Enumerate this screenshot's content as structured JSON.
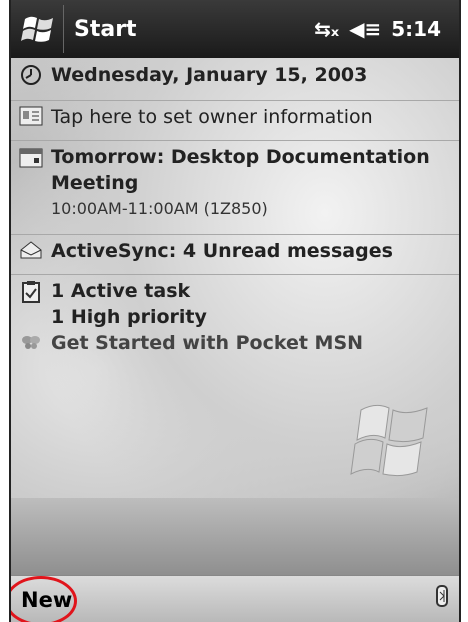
{
  "titlebar": {
    "title": "Start",
    "time": "5:14",
    "connectivity_icon": "connectivity-icon",
    "volume_icon": "speaker-icon"
  },
  "today": {
    "date": "Wednesday, January 15, 2003",
    "owner": "Tap here to set owner information",
    "appointment_title_line1": "Tomorrow: Desktop Documentation",
    "appointment_title_line2": "Meeting",
    "appointment_time": "10:00AM-11:00AM (1Z850)",
    "activesync": "ActiveSync: 4 Unread messages",
    "tasks_line1": "1 Active task",
    "tasks_line2": "1 High priority",
    "msn": "Get Started with Pocket MSN"
  },
  "bottombar": {
    "new_label": "New"
  },
  "colors": {
    "highlight_circle": "#e0141b"
  }
}
